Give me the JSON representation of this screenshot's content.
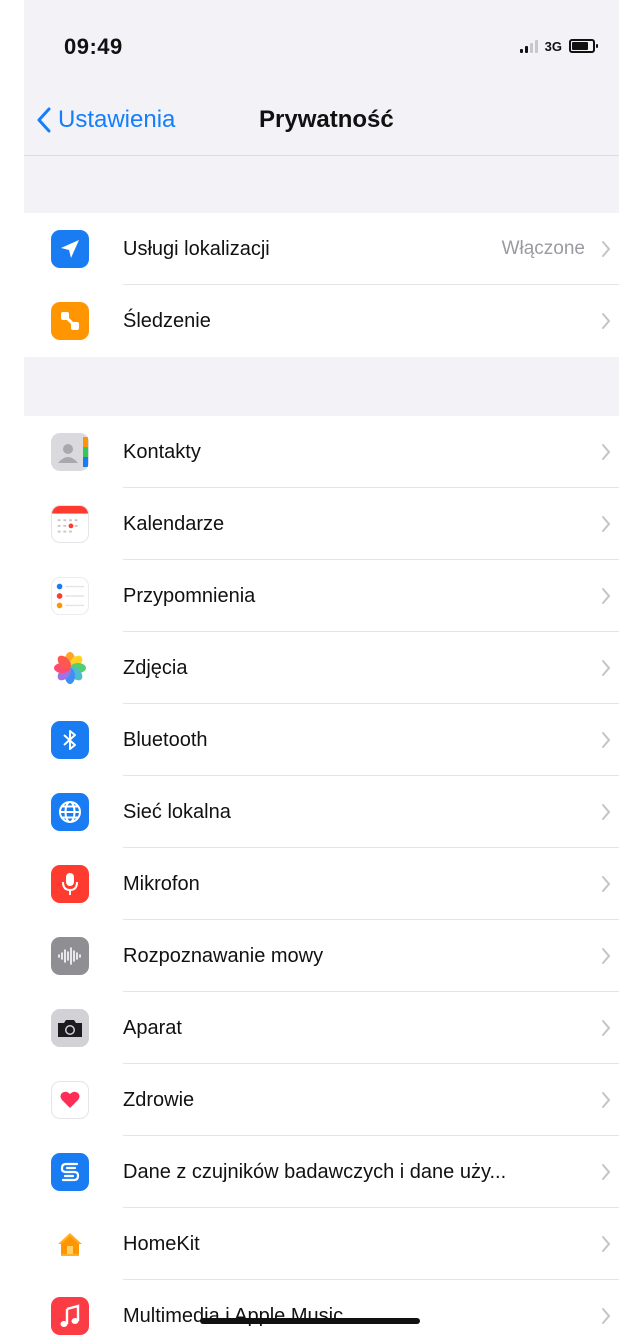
{
  "status_bar": {
    "time": "09:49",
    "network": "3G"
  },
  "nav": {
    "back_label": "Ustawienia",
    "title": "Prywatność"
  },
  "group1": [
    {
      "label": "Usługi lokalizacji",
      "value": "Włączone",
      "icon": "location-arrow-icon"
    },
    {
      "label": "Śledzenie",
      "icon": "tracking-icon"
    }
  ],
  "group2": [
    {
      "label": "Kontakty",
      "icon": "contacts-icon"
    },
    {
      "label": "Kalendarze",
      "icon": "calendar-icon"
    },
    {
      "label": "Przypomnienia",
      "icon": "reminders-icon"
    },
    {
      "label": "Zdjęcia",
      "icon": "photos-icon"
    },
    {
      "label": "Bluetooth",
      "icon": "bluetooth-icon"
    },
    {
      "label": "Sieć lokalna",
      "icon": "globe-icon"
    },
    {
      "label": "Mikrofon",
      "icon": "microphone-icon"
    },
    {
      "label": "Rozpoznawanie mowy",
      "icon": "waveform-icon"
    },
    {
      "label": "Aparat",
      "icon": "camera-icon"
    },
    {
      "label": "Zdrowie",
      "icon": "heart-icon"
    },
    {
      "label": "Dane z czujników badawczych i dane uży...",
      "icon": "research-sensor-icon"
    },
    {
      "label": "HomeKit",
      "icon": "home-icon"
    },
    {
      "label": "Multimedia i Apple Music",
      "icon": "music-note-icon"
    }
  ],
  "colors": {
    "accent": "#147efb",
    "background": "#f2f2f7",
    "location": "#1a7cf3",
    "tracking": "#ff9500",
    "bluetooth": "#1a7cf3",
    "microphone": "#ff3b30",
    "music": "#fc3c44"
  }
}
